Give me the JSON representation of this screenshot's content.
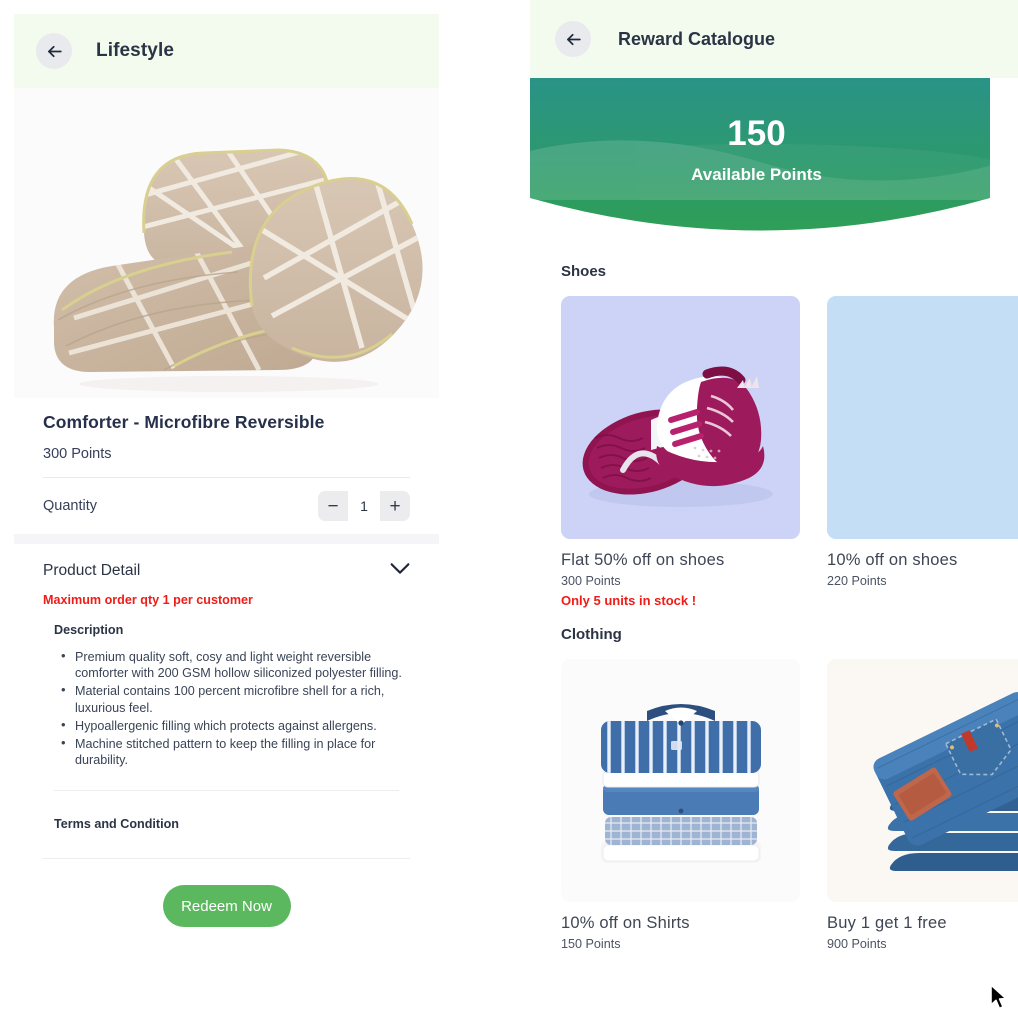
{
  "product_page": {
    "header": {
      "back_icon": "arrow-left-icon",
      "title": "Lifestyle"
    },
    "hero_image_alt": "comforter-and-pillows",
    "name": "Comforter - Microfibre Reversible",
    "points": "300 Points",
    "quantity": {
      "label": "Quantity",
      "minus": "−",
      "value": "1",
      "plus": "+"
    },
    "detail": {
      "heading": "Product Detail",
      "chevron_icon": "chevron-down-icon",
      "warning": "Maximum order qty 1 per customer",
      "description_heading": "Description",
      "bullets": [
        "Premium quality soft, cosy and light weight reversible comforter with 200 GSM hollow siliconized polyester filling.",
        "Material contains 100 percent microfibre shell for a rich, luxurious feel.",
        "Hypoallergenic filling which protects against allergens.",
        "Machine stitched pattern to keep the filling in place for durability."
      ]
    },
    "terms": "Terms and Condition",
    "redeem_label": "Redeem Now"
  },
  "catalogue_page": {
    "header": {
      "back_icon": "arrow-left-icon",
      "title": "Reward Catalogue"
    },
    "banner": {
      "points": "150",
      "label": "Available Points"
    },
    "sections": [
      {
        "title": "Shoes",
        "items": [
          {
            "title": "Flat 50% off on shoes",
            "points": "300 Points",
            "stock": "Only 5 units in stock !",
            "image": "magenta-white-sneakers"
          },
          {
            "title": "10% off on shoes",
            "points": "220 Points",
            "stock": "",
            "image": "light-blue-placeholder"
          }
        ]
      },
      {
        "title": "Clothing",
        "items": [
          {
            "title": "10% off on Shirts",
            "points": "150 Points",
            "stock": "",
            "image": "stack-of-folded-shirts"
          },
          {
            "title": "Buy 1 get 1 free",
            "points": "900 Points",
            "stock": "",
            "image": "folded-blue-jeans"
          }
        ]
      }
    ]
  },
  "colors": {
    "header_bg": "#f3fbee",
    "banner_top": "#2a9387",
    "banner_bottom": "#2e9e57",
    "accent_green": "#5cb85f",
    "alert_red": "#ef1c18",
    "text_dark": "#2b3445"
  },
  "cursor": {
    "icon": "mouse-pointer-icon"
  }
}
